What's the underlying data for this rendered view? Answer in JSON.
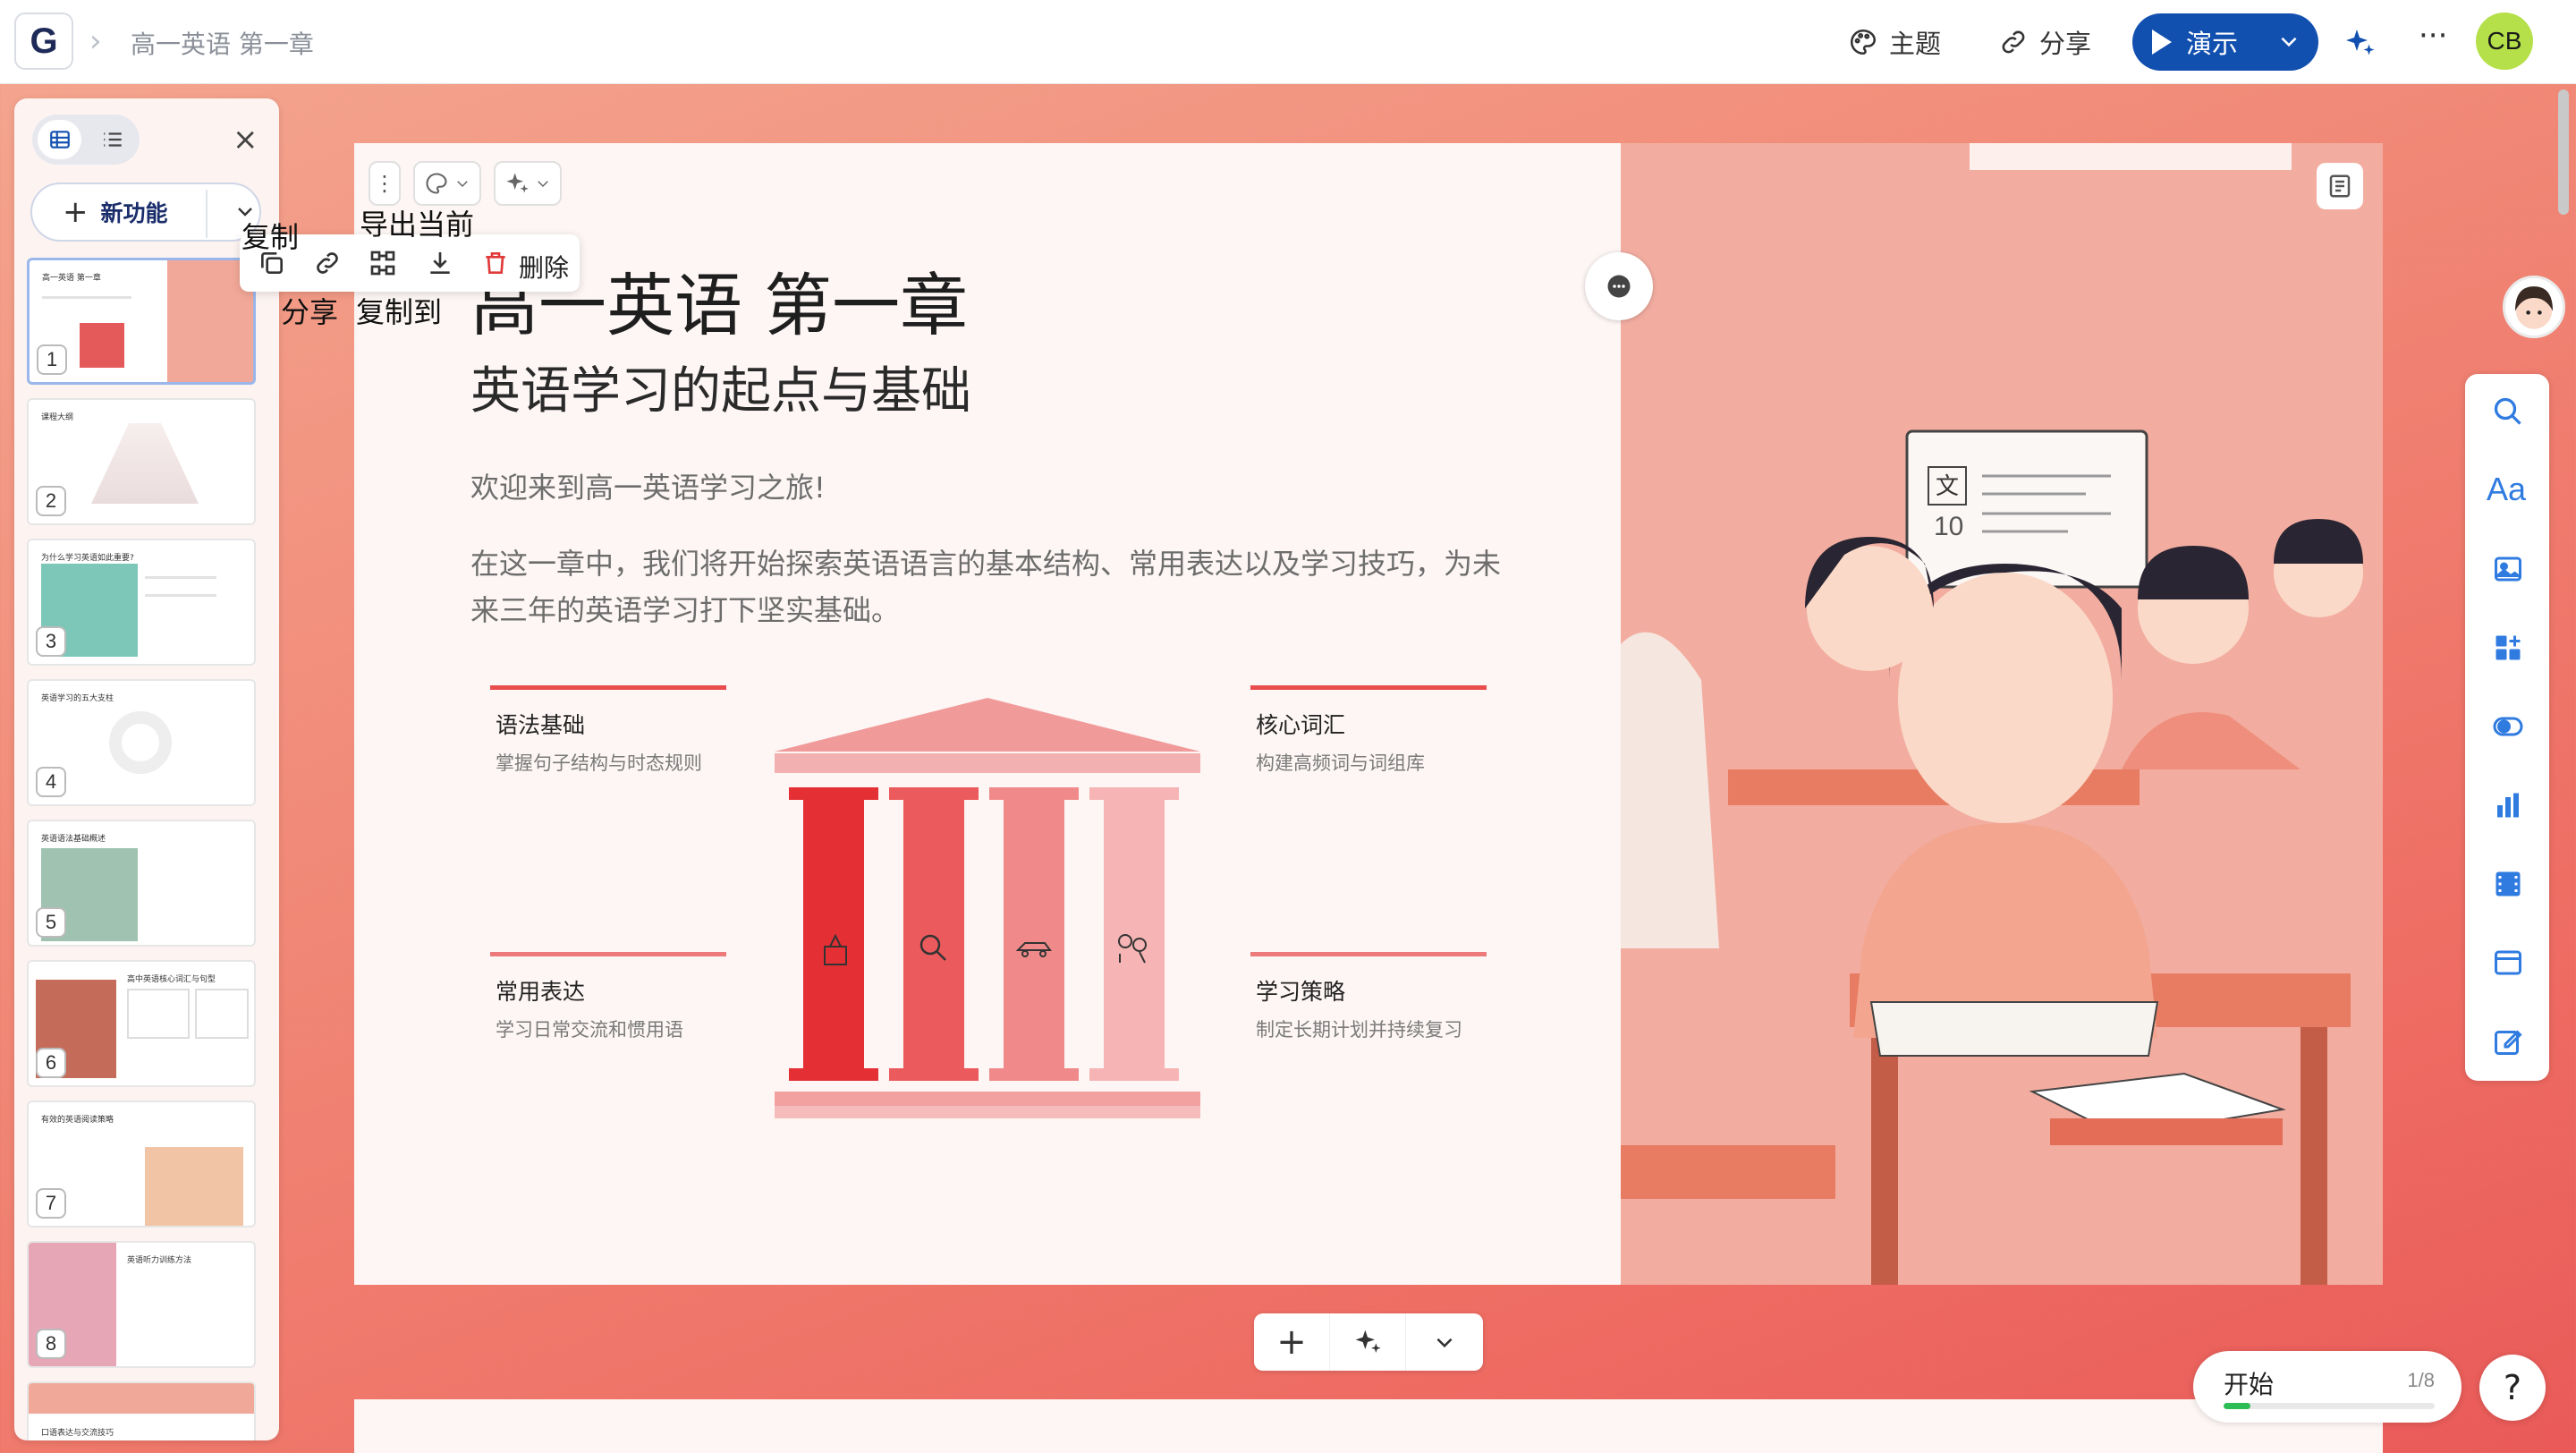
{
  "app": {
    "doc_title": "高一英语 第一章",
    "logo": "G"
  },
  "topbar": {
    "theme_label": "主题",
    "share_label": "分享",
    "present_label": "演示",
    "user_initials": "CB"
  },
  "sidebar": {
    "new_feature_label": "新功能",
    "slides": [
      {
        "num": "1",
        "title": "高一英语 第一章"
      },
      {
        "num": "2",
        "title": "课程大纲"
      },
      {
        "num": "3",
        "title": "为什么学习英语如此重要?"
      },
      {
        "num": "4",
        "title": "英语学习的五大支柱"
      },
      {
        "num": "5",
        "title": "英语语法基础概述"
      },
      {
        "num": "6",
        "title": "高中英语核心词汇与句型"
      },
      {
        "num": "7",
        "title": "有效的英语阅读策略"
      },
      {
        "num": "8",
        "title": "英语听力训练方法"
      },
      {
        "num": "",
        "title": "口语表达与交流技巧"
      }
    ]
  },
  "popup": {
    "copy_tip": "复制",
    "export_tip": "导出当前",
    "delete_label": "删除",
    "share_tip": "分享",
    "copy_to_tip": "复制到"
  },
  "slide": {
    "title": "高一英语 第一章",
    "subtitle": "英语学习的起点与基础",
    "welcome": "欢迎来到高一英语学习之旅!",
    "paragraph": "在这一章中，我们将开始探索英语语言的基本结构、常用表达以及学习技巧，为未来三年的英语学习打下坚实基础。",
    "pillars": [
      {
        "title": "语法基础",
        "desc": "掌握句子结构与时态规则"
      },
      {
        "title": "核心词汇",
        "desc": "构建高频词与词组库"
      },
      {
        "title": "常用表达",
        "desc": "学习日常交流和惯用语"
      },
      {
        "title": "学习策略",
        "desc": "制定长期计划并持续复习"
      }
    ],
    "board_text": "10"
  },
  "progress": {
    "start_label": "开始",
    "count": "1/8",
    "fraction": 0.125
  },
  "help_label": "?"
}
